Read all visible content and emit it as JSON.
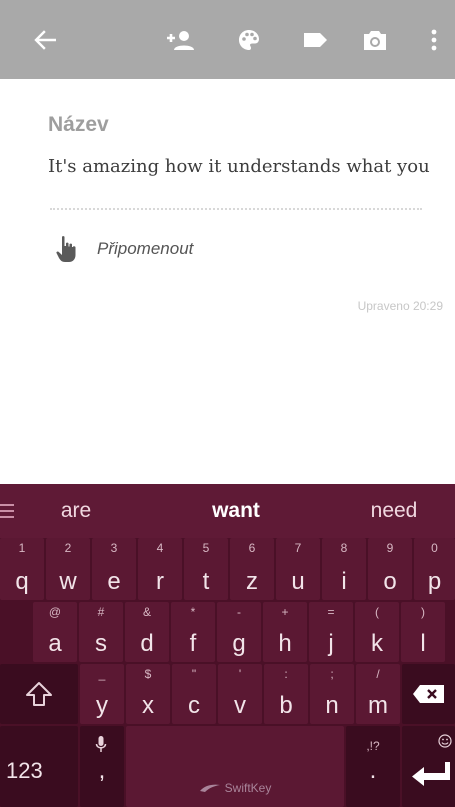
{
  "toolbar": {
    "icons": {
      "back": "arrow-left",
      "add_person": "person-add",
      "palette": "palette",
      "label": "label-tag",
      "camera": "camera",
      "more": "more-vertical"
    },
    "color": "#a9a9a9"
  },
  "note": {
    "title_placeholder": "Název",
    "body": "It's amazing how it understands what you",
    "reminder_label": "Připomenout",
    "reminder_icon": "hand-pointer",
    "edited": "Upraveno 20:29"
  },
  "keyboard": {
    "colors": {
      "background": "#4a1027",
      "key": "#5b1833",
      "suggestion_bar": "#5f1a36"
    },
    "suggestions": [
      "are",
      "want",
      "need"
    ],
    "row1": [
      {
        "main": "q",
        "hint": "1"
      },
      {
        "main": "w",
        "hint": "2"
      },
      {
        "main": "e",
        "hint": "3"
      },
      {
        "main": "r",
        "hint": "4"
      },
      {
        "main": "t",
        "hint": "5"
      },
      {
        "main": "z",
        "hint": "6"
      },
      {
        "main": "u",
        "hint": "7"
      },
      {
        "main": "i",
        "hint": "8"
      },
      {
        "main": "o",
        "hint": "9"
      },
      {
        "main": "p",
        "hint": "0"
      }
    ],
    "row2": [
      {
        "main": "a",
        "hint": "@"
      },
      {
        "main": "s",
        "hint": "#"
      },
      {
        "main": "d",
        "hint": "&"
      },
      {
        "main": "f",
        "hint": "*"
      },
      {
        "main": "g",
        "hint": "-"
      },
      {
        "main": "h",
        "hint": "+"
      },
      {
        "main": "j",
        "hint": "="
      },
      {
        "main": "k",
        "hint": "("
      },
      {
        "main": "l",
        "hint": ")"
      }
    ],
    "row3": [
      {
        "main": "y",
        "hint": "_"
      },
      {
        "main": "x",
        "hint": "$"
      },
      {
        "main": "c",
        "hint": "\""
      },
      {
        "main": "v",
        "hint": "'"
      },
      {
        "main": "b",
        "hint": ":"
      },
      {
        "main": "n",
        "hint": ";"
      },
      {
        "main": "m",
        "hint": "/"
      }
    ],
    "numbers_label": "123",
    "comma_label": ",",
    "space_brand": "SwiftKey",
    "period_label": ".",
    "period_hint": ",!?",
    "icons": {
      "shift": "shift-arrow",
      "backspace": "backspace",
      "mic": "microphone",
      "emoji": "emoji",
      "enter": "enter-return",
      "menu": "hamburger-menu"
    }
  }
}
